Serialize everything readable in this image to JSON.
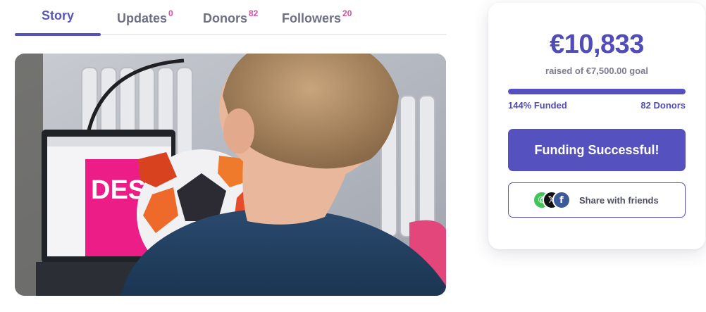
{
  "tabs": [
    {
      "label": "Story",
      "count": ""
    },
    {
      "label": "Updates",
      "count": "0"
    },
    {
      "label": "Donors",
      "count": "82"
    },
    {
      "label": "Followers",
      "count": "20"
    }
  ],
  "active_tab": "Story",
  "hero_image": {
    "screen_text": "DES"
  },
  "funding": {
    "amount": "€10,833",
    "goal_text": "raised of €7,500.00 goal",
    "progress_fraction": 1.0,
    "funded_label": "144% Funded",
    "donors_label": "82 Donors",
    "status_button": "Funding Successful!",
    "share_label": "Share with friends",
    "share_icons": [
      "whatsapp-icon",
      "x-icon",
      "facebook-icon"
    ]
  },
  "colors": {
    "accent": "#5552c0",
    "badge": "#d94fa0",
    "whatsapp": "#43c45a",
    "facebook": "#3d5a98"
  }
}
